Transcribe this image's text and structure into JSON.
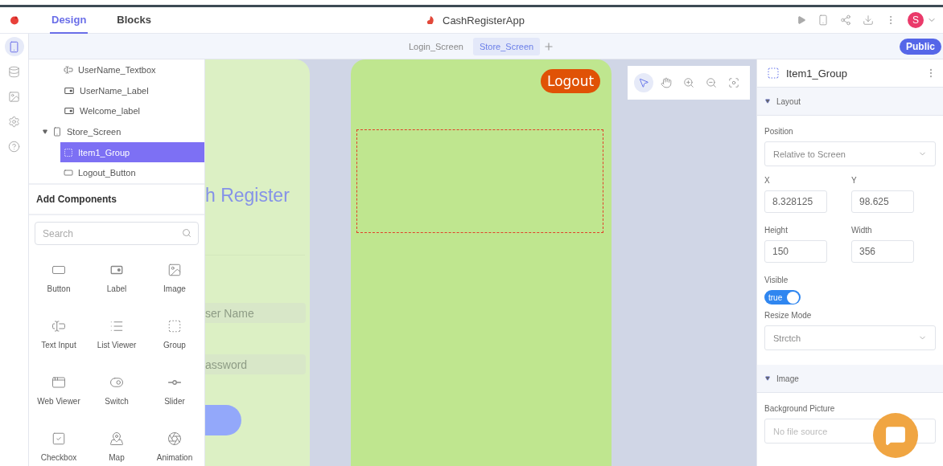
{
  "app": {
    "title": "CashRegisterApp"
  },
  "mode_tabs": [
    {
      "label": "Design",
      "selected": true
    },
    {
      "label": "Blocks",
      "selected": false
    }
  ],
  "avatar": {
    "initial": "S"
  },
  "rail": [
    {
      "kind": "screens",
      "selected": true
    },
    {
      "kind": "data",
      "selected": false
    },
    {
      "kind": "media",
      "selected": false
    },
    {
      "kind": "settings",
      "selected": false
    },
    {
      "kind": "help",
      "selected": false
    }
  ],
  "screen_tabs": [
    {
      "label": "Login_Screen",
      "selected": false
    },
    {
      "label": "Store_Screen",
      "selected": true
    }
  ],
  "visibility_badge": "Public",
  "tree": {
    "scrolled_children": [
      {
        "label": "UserName_Textbox",
        "kind": "textbox",
        "selected": false
      },
      {
        "label": "UserName_Label",
        "kind": "label",
        "selected": false
      },
      {
        "label": "Welcome_label",
        "kind": "label",
        "selected": false
      }
    ],
    "items": [
      {
        "label": "Store_Screen",
        "kind": "screen",
        "selected": false,
        "expanded": true,
        "children": [
          {
            "label": "Item1_Group",
            "kind": "group",
            "selected": true
          },
          {
            "label": "Logout_Button",
            "kind": "button",
            "selected": false
          }
        ]
      }
    ]
  },
  "add_components": {
    "title": "Add Components",
    "search": {
      "placeholder": "Search"
    },
    "items": [
      {
        "label": "Button",
        "kind": "button"
      },
      {
        "label": "Label",
        "kind": "label"
      },
      {
        "label": "Image",
        "kind": "image"
      },
      {
        "label": "Text Input",
        "kind": "textinput"
      },
      {
        "label": "List Viewer",
        "kind": "list"
      },
      {
        "label": "Group",
        "kind": "group"
      },
      {
        "label": "Web Viewer",
        "kind": "web"
      },
      {
        "label": "Switch",
        "kind": "switch"
      },
      {
        "label": "Slider",
        "kind": "slider"
      },
      {
        "label": "Checkbox",
        "kind": "checkbox"
      },
      {
        "label": "Map",
        "kind": "map"
      },
      {
        "label": "Animation",
        "kind": "animation"
      }
    ]
  },
  "canvas": {
    "login_preview": {
      "title": "h Register",
      "fields": [
        {
          "placeholder": "ser Name"
        },
        {
          "placeholder": "assword"
        }
      ]
    },
    "store_preview": {
      "button": "Logout",
      "group": {
        "selected": true
      }
    },
    "tools": [
      {
        "kind": "select",
        "selected": true
      },
      {
        "kind": "pan",
        "selected": false
      },
      {
        "kind": "zoom_in",
        "selected": false
      },
      {
        "kind": "zoom_out",
        "selected": false
      },
      {
        "kind": "fit",
        "selected": false
      }
    ]
  },
  "properties": {
    "title": "Item1_Group",
    "sections": [
      {
        "title": "Layout",
        "expanded": true,
        "fields": [
          {
            "kind": "select",
            "label": "Position",
            "value": "Relative to Screen"
          },
          {
            "kind": "pair",
            "items": [
              {
                "label": "X",
                "value": "8.328125"
              },
              {
                "label": "Y",
                "value": "98.625"
              }
            ]
          },
          {
            "kind": "pair",
            "items": [
              {
                "label": "Height",
                "value": "150"
              },
              {
                "label": "Width",
                "value": "356"
              }
            ]
          },
          {
            "kind": "switch",
            "label": "Visible",
            "value": "true",
            "on": true
          },
          {
            "kind": "select",
            "label": "Resize Mode",
            "value": "Strctch"
          }
        ]
      },
      {
        "title": "Image",
        "expanded": true,
        "fields": [
          {
            "kind": "file",
            "label": "Background Picture",
            "placeholder": "No file source"
          }
        ]
      }
    ]
  }
}
